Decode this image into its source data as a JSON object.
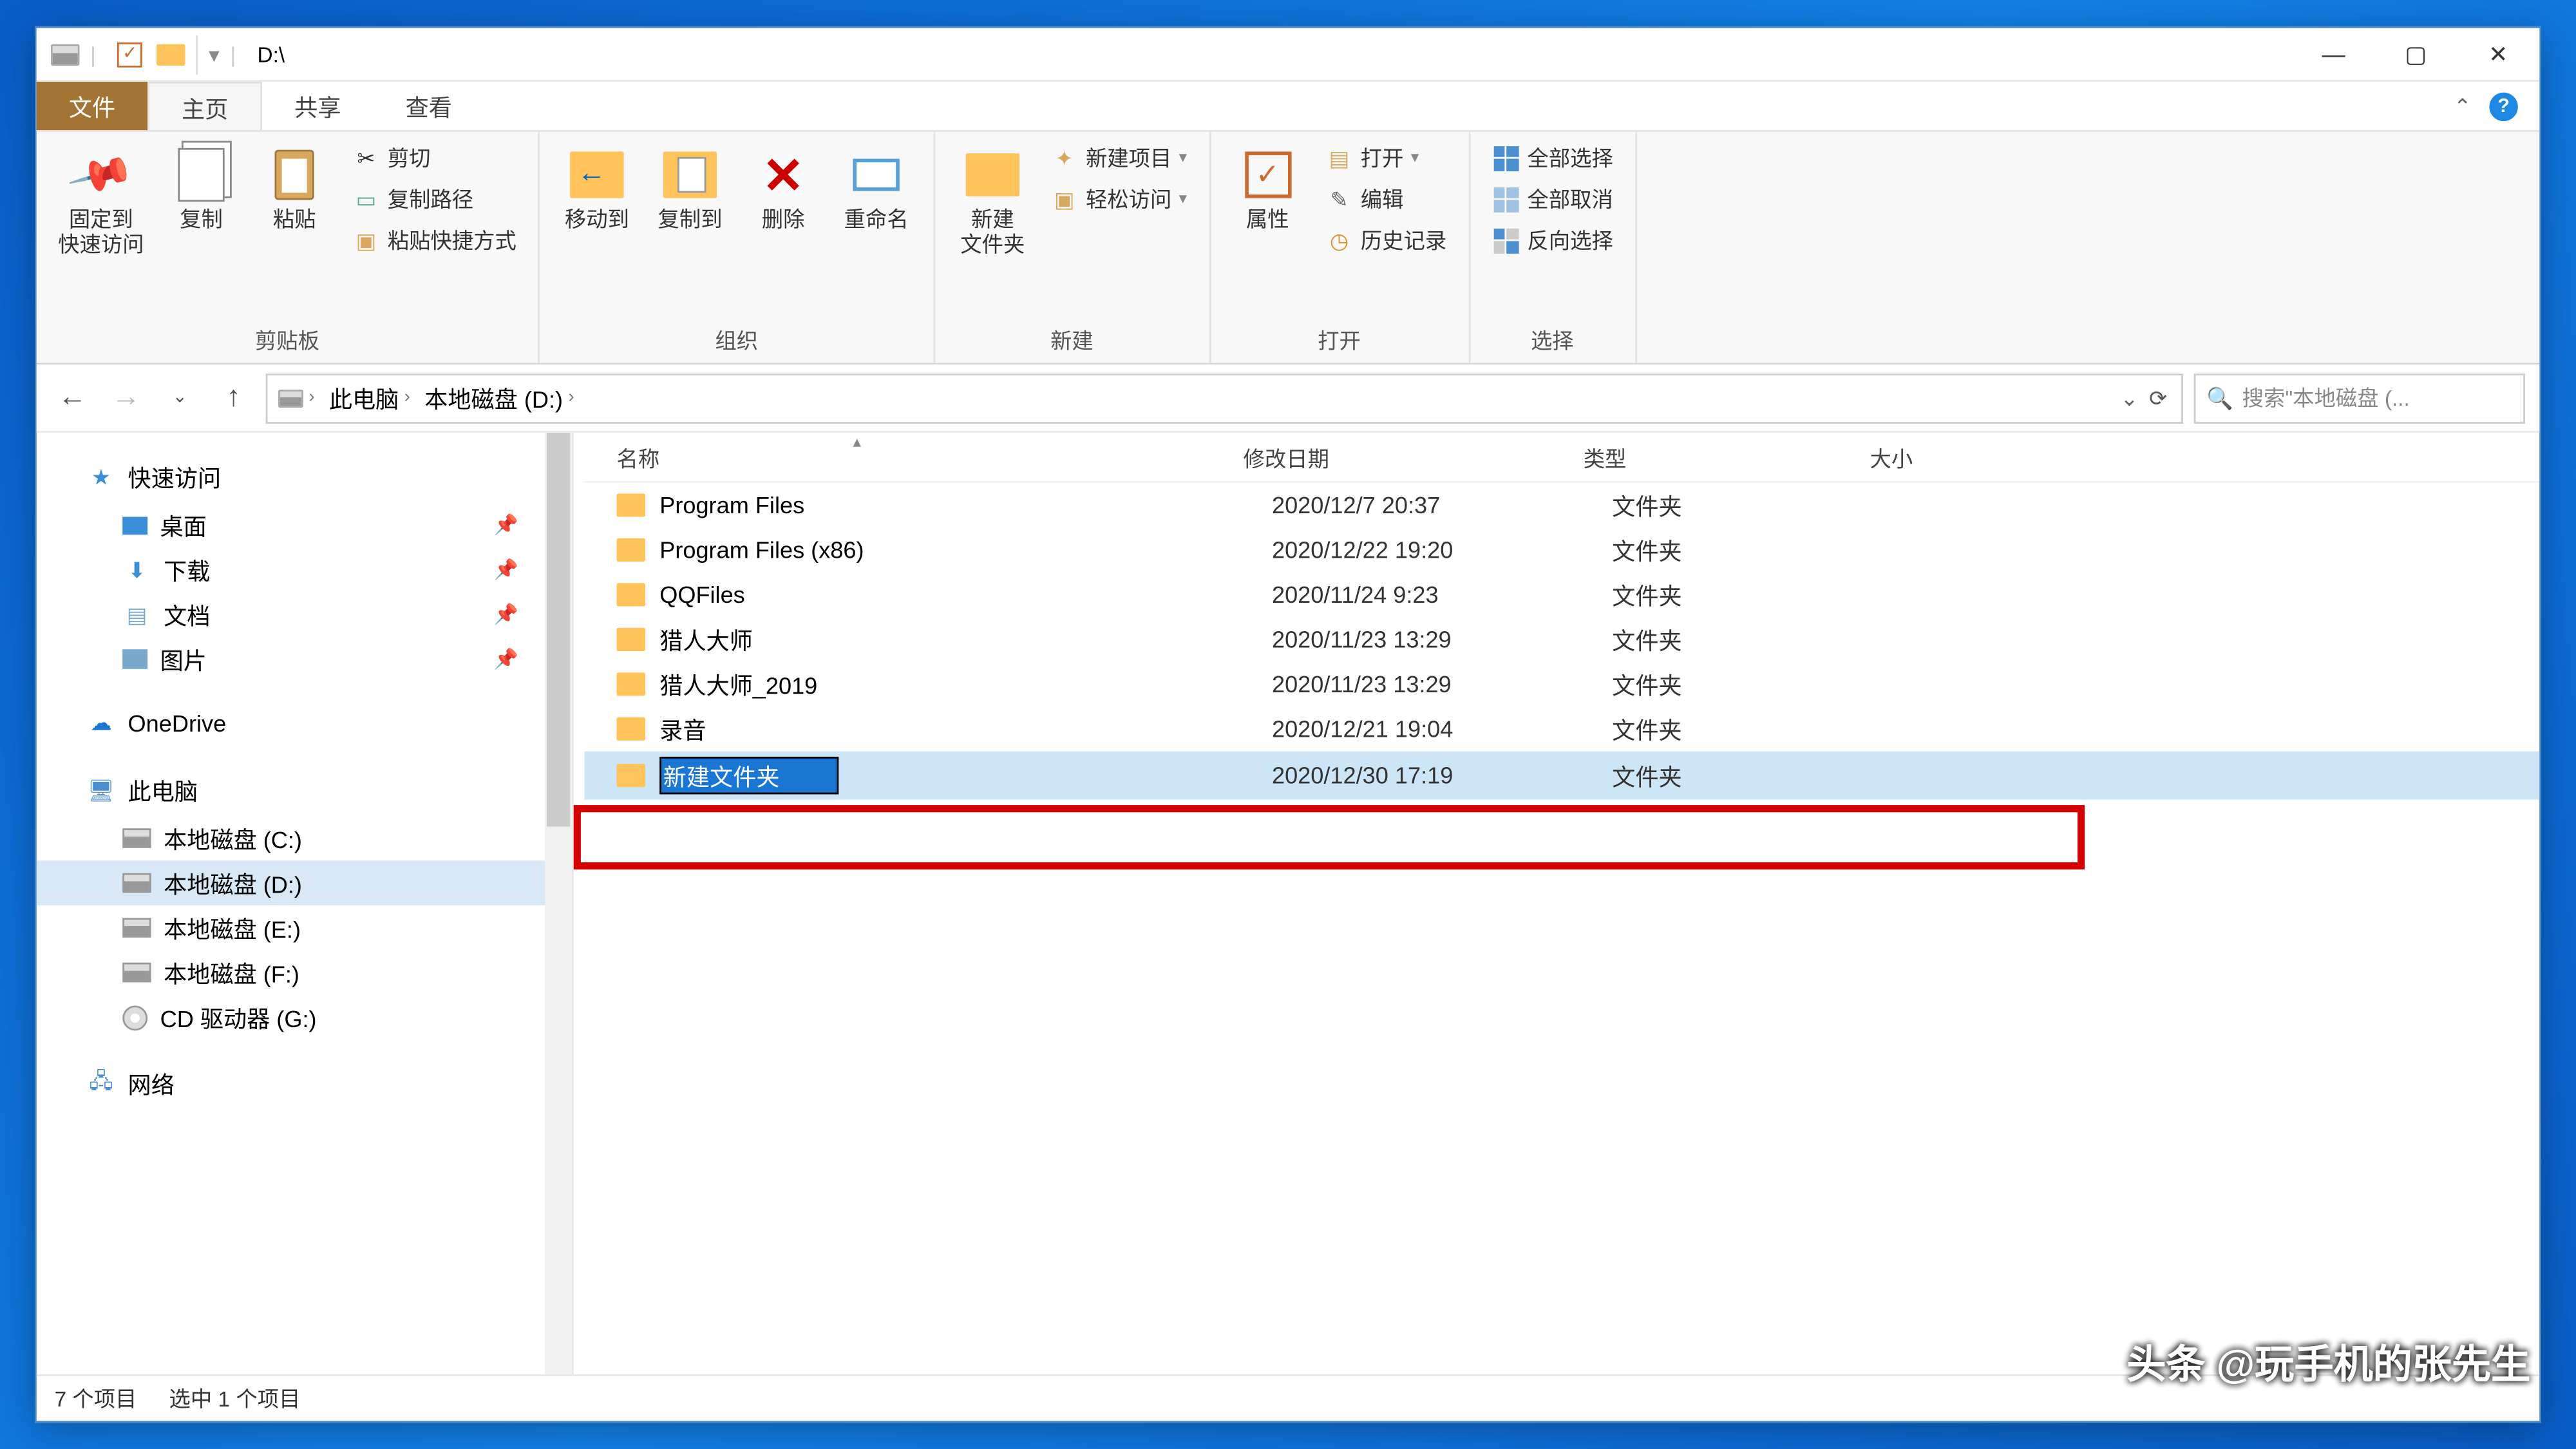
{
  "title_bar": {
    "path": "D:\\"
  },
  "window_controls": {
    "min": "—",
    "max": "▢",
    "close": "✕"
  },
  "tabs": {
    "file": "文件",
    "home": "主页",
    "share": "共享",
    "view": "查看"
  },
  "ribbon": {
    "clipboard": {
      "pin": "固定到\n快速访问",
      "copy": "复制",
      "paste": "粘贴",
      "cut": "剪切",
      "copy_path": "复制路径",
      "paste_shortcut": "粘贴快捷方式",
      "label": "剪贴板"
    },
    "organize": {
      "move_to": "移动到",
      "copy_to": "复制到",
      "delete": "删除",
      "rename": "重命名",
      "label": "组织"
    },
    "new": {
      "new_folder": "新建\n文件夹",
      "new_item": "新建项目",
      "easy_access": "轻松访问",
      "label": "新建"
    },
    "open": {
      "properties": "属性",
      "open": "打开",
      "edit": "编辑",
      "history": "历史记录",
      "label": "打开"
    },
    "select": {
      "all": "全部选择",
      "none": "全部取消",
      "invert": "反向选择",
      "label": "选择"
    }
  },
  "breadcrumb": {
    "this_pc": "此电脑",
    "drive": "本地磁盘 (D:)"
  },
  "search": {
    "placeholder": "搜索\"本地磁盘 (..."
  },
  "nav": {
    "quick_access": "快速访问",
    "desktop": "桌面",
    "downloads": "下载",
    "documents": "文档",
    "pictures": "图片",
    "onedrive": "OneDrive",
    "this_pc": "此电脑",
    "drive_c": "本地磁盘 (C:)",
    "drive_d": "本地磁盘 (D:)",
    "drive_e": "本地磁盘 (E:)",
    "drive_f": "本地磁盘 (F:)",
    "cd_drive": "CD 驱动器 (G:)",
    "network": "网络"
  },
  "columns": {
    "name": "名称",
    "date": "修改日期",
    "type": "类型",
    "size": "大小"
  },
  "rows": [
    {
      "name": "Program Files",
      "date": "2020/12/7 20:37",
      "type": "文件夹"
    },
    {
      "name": "Program Files (x86)",
      "date": "2020/12/22 19:20",
      "type": "文件夹"
    },
    {
      "name": "QQFiles",
      "date": "2020/11/24 9:23",
      "type": "文件夹"
    },
    {
      "name": "猎人大师",
      "date": "2020/11/23 13:29",
      "type": "文件夹"
    },
    {
      "name": "猎人大师_2019",
      "date": "2020/11/23 13:29",
      "type": "文件夹"
    },
    {
      "name": "录音",
      "date": "2020/12/21 19:04",
      "type": "文件夹"
    },
    {
      "name": "新建文件夹",
      "date": "2020/12/30 17:19",
      "type": "文件夹",
      "editing": true
    }
  ],
  "status": {
    "count": "7 个项目",
    "selection": "选中 1 个项目"
  },
  "watermark": "头条 @玩手机的张先生"
}
